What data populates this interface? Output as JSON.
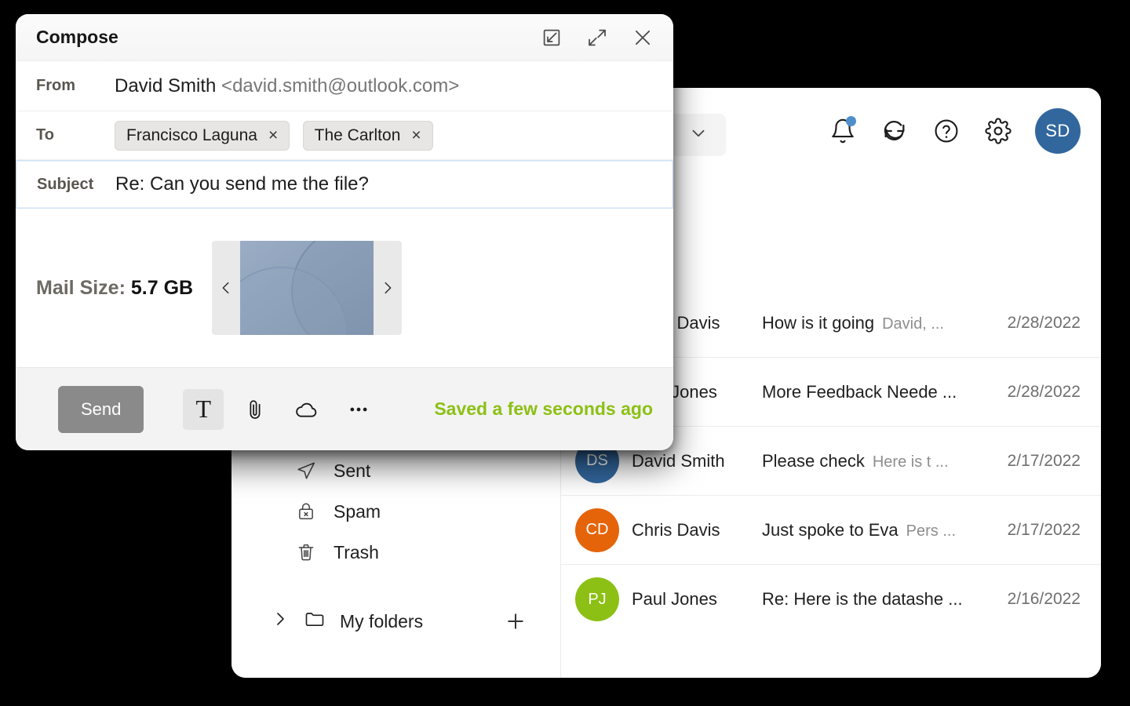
{
  "mail_app": {
    "topbar": {
      "search_chevron_icon": "chevron-down-icon",
      "actions": [
        {
          "icon": "bell-icon",
          "label": "Notifications",
          "badge": true
        },
        {
          "icon": "refresh-icon",
          "label": "Sync"
        },
        {
          "icon": "help-icon",
          "label": "Help"
        },
        {
          "icon": "gear-icon",
          "label": "Settings"
        }
      ],
      "avatar": {
        "initials": "SD",
        "color": "#32679e"
      }
    },
    "sidebar": {
      "folders": [
        {
          "label": "Sent",
          "icon": "send-icon"
        },
        {
          "label": "Spam",
          "icon": "spam-icon"
        },
        {
          "label": "Trash",
          "icon": "trash-icon"
        }
      ],
      "my_folders": {
        "label": "My folders",
        "expand_icon": "chevron-right-icon",
        "folder_icon": "folder-icon",
        "add_icon": "plus-icon"
      }
    },
    "maillist": {
      "rows": [
        {
          "initials": "",
          "color": "",
          "sender": "Chris Davis",
          "subject": "How is it going",
          "preview": "David, ...",
          "date": "2/28/2022"
        },
        {
          "initials": "",
          "color": "",
          "sender": "Paul Jones",
          "subject": "More Feedback Neede ...",
          "preview": "",
          "date": "2/28/2022"
        },
        {
          "initials": "DS",
          "color": "#32679e",
          "sender": "David Smith",
          "subject": "Please check",
          "preview": "Here is t ...",
          "date": "2/17/2022"
        },
        {
          "initials": "CD",
          "color": "#e5640a",
          "sender": "Chris Davis",
          "subject": "Just spoke to Eva",
          "preview": "Pers ...",
          "date": "2/17/2022"
        },
        {
          "initials": "PJ",
          "color": "#8cc014",
          "sender": "Paul Jones",
          "subject": "Re: Here is the datashe ...",
          "preview": "",
          "date": "2/16/2022"
        }
      ]
    }
  },
  "compose": {
    "title": "Compose",
    "header_actions": [
      {
        "icon": "popout-icon",
        "label": "Pop out"
      },
      {
        "icon": "expand-icon",
        "label": "Expand"
      },
      {
        "icon": "close-icon",
        "label": "Close"
      }
    ],
    "from": {
      "label": "From",
      "name": "David Smith",
      "email": "<david.smith@outlook.com>"
    },
    "to": {
      "label": "To",
      "recipients": [
        {
          "name": "Francisco Laguna",
          "remove": "×"
        },
        {
          "name": "The Carlton",
          "remove": "×"
        }
      ]
    },
    "subject": {
      "label": "Subject",
      "value": "Re: Can you send me the file?",
      "placeholder": "Subject"
    },
    "body": {
      "mail_size_label": "Mail Size:",
      "mail_size_value": "5.7 GB",
      "carousel": {
        "prev_icon": "chevron-left-icon",
        "next_icon": "chevron-right-icon",
        "attachment_alt": "attachment-preview"
      }
    },
    "toolbar": {
      "send_label": "Send",
      "tools": [
        {
          "icon": "text-format-icon",
          "glyph": "T",
          "label": "Formatting options",
          "active": true
        },
        {
          "icon": "paperclip-icon",
          "label": "Attach file"
        },
        {
          "icon": "cloud-icon",
          "label": "Attach from cloud"
        },
        {
          "icon": "more-icon",
          "label": "More options"
        }
      ],
      "saved_status": "Saved a few seconds ago",
      "saved_color": "#8cc014"
    }
  }
}
